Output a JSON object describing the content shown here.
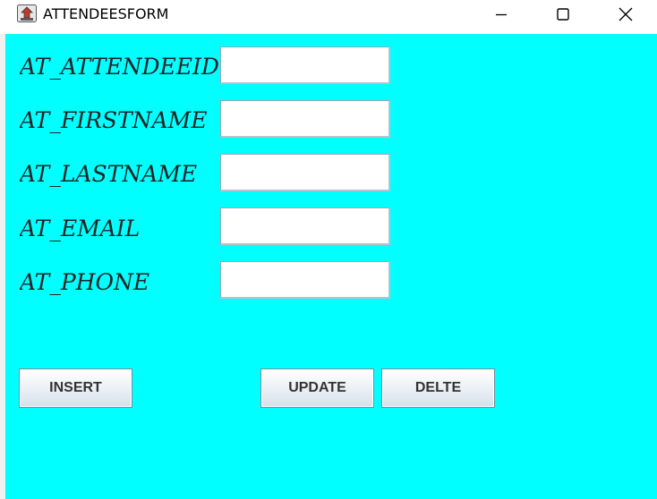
{
  "window": {
    "title": "ATTENDEESFORM",
    "icon": "java-coffee-cup-icon"
  },
  "colors": {
    "client_background": "#00ffff",
    "titlebar_background": "#ffffff"
  },
  "form": {
    "fields": [
      {
        "label": "AT_ATTENDEEID",
        "value": "",
        "placeholder": ""
      },
      {
        "label": "AT_FIRSTNAME",
        "value": "",
        "placeholder": ""
      },
      {
        "label": "AT_LASTNAME",
        "value": "",
        "placeholder": ""
      },
      {
        "label": "AT_EMAIL",
        "value": "",
        "placeholder": ""
      },
      {
        "label": "AT_PHONE",
        "value": "",
        "placeholder": ""
      }
    ]
  },
  "buttons": {
    "insert": "INSERT",
    "update": "UPDATE",
    "delete": "DELTE"
  }
}
